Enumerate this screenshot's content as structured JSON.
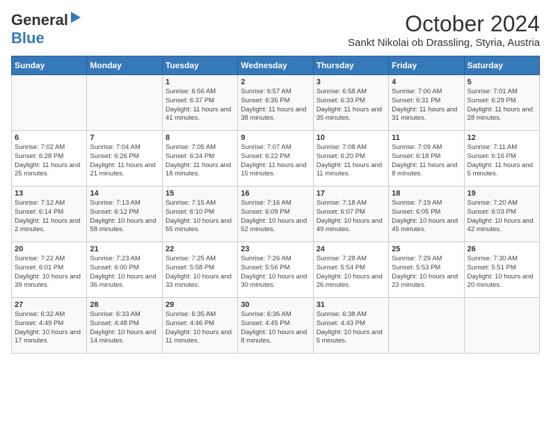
{
  "header": {
    "logo_general": "General",
    "logo_blue": "Blue",
    "title": "October 2024",
    "subtitle": "Sankt Nikolai ob Drassling, Styria, Austria"
  },
  "calendar": {
    "days_of_week": [
      "Sunday",
      "Monday",
      "Tuesday",
      "Wednesday",
      "Thursday",
      "Friday",
      "Saturday"
    ],
    "weeks": [
      [
        {
          "day": "",
          "info": ""
        },
        {
          "day": "",
          "info": ""
        },
        {
          "day": "1",
          "info": "Sunrise: 6:56 AM\nSunset: 6:37 PM\nDaylight: 11 hours and 41 minutes."
        },
        {
          "day": "2",
          "info": "Sunrise: 6:57 AM\nSunset: 6:35 PM\nDaylight: 11 hours and 38 minutes."
        },
        {
          "day": "3",
          "info": "Sunrise: 6:58 AM\nSunset: 6:33 PM\nDaylight: 11 hours and 35 minutes."
        },
        {
          "day": "4",
          "info": "Sunrise: 7:00 AM\nSunset: 6:31 PM\nDaylight: 11 hours and 31 minutes."
        },
        {
          "day": "5",
          "info": "Sunrise: 7:01 AM\nSunset: 6:29 PM\nDaylight: 11 hours and 28 minutes."
        }
      ],
      [
        {
          "day": "6",
          "info": "Sunrise: 7:02 AM\nSunset: 6:28 PM\nDaylight: 11 hours and 25 minutes."
        },
        {
          "day": "7",
          "info": "Sunrise: 7:04 AM\nSunset: 6:26 PM\nDaylight: 11 hours and 21 minutes."
        },
        {
          "day": "8",
          "info": "Sunrise: 7:05 AM\nSunset: 6:24 PM\nDaylight: 11 hours and 18 minutes."
        },
        {
          "day": "9",
          "info": "Sunrise: 7:07 AM\nSunset: 6:22 PM\nDaylight: 11 hours and 15 minutes."
        },
        {
          "day": "10",
          "info": "Sunrise: 7:08 AM\nSunset: 6:20 PM\nDaylight: 11 hours and 11 minutes."
        },
        {
          "day": "11",
          "info": "Sunrise: 7:09 AM\nSunset: 6:18 PM\nDaylight: 11 hours and 8 minutes."
        },
        {
          "day": "12",
          "info": "Sunrise: 7:11 AM\nSunset: 6:16 PM\nDaylight: 11 hours and 5 minutes."
        }
      ],
      [
        {
          "day": "13",
          "info": "Sunrise: 7:12 AM\nSunset: 6:14 PM\nDaylight: 11 hours and 2 minutes."
        },
        {
          "day": "14",
          "info": "Sunrise: 7:13 AM\nSunset: 6:12 PM\nDaylight: 10 hours and 58 minutes."
        },
        {
          "day": "15",
          "info": "Sunrise: 7:15 AM\nSunset: 6:10 PM\nDaylight: 10 hours and 55 minutes."
        },
        {
          "day": "16",
          "info": "Sunrise: 7:16 AM\nSunset: 6:09 PM\nDaylight: 10 hours and 52 minutes."
        },
        {
          "day": "17",
          "info": "Sunrise: 7:18 AM\nSunset: 6:07 PM\nDaylight: 10 hours and 49 minutes."
        },
        {
          "day": "18",
          "info": "Sunrise: 7:19 AM\nSunset: 6:05 PM\nDaylight: 10 hours and 45 minutes."
        },
        {
          "day": "19",
          "info": "Sunrise: 7:20 AM\nSunset: 6:03 PM\nDaylight: 10 hours and 42 minutes."
        }
      ],
      [
        {
          "day": "20",
          "info": "Sunrise: 7:22 AM\nSunset: 6:01 PM\nDaylight: 10 hours and 39 minutes."
        },
        {
          "day": "21",
          "info": "Sunrise: 7:23 AM\nSunset: 6:00 PM\nDaylight: 10 hours and 36 minutes."
        },
        {
          "day": "22",
          "info": "Sunrise: 7:25 AM\nSunset: 5:58 PM\nDaylight: 10 hours and 33 minutes."
        },
        {
          "day": "23",
          "info": "Sunrise: 7:26 AM\nSunset: 5:56 PM\nDaylight: 10 hours and 30 minutes."
        },
        {
          "day": "24",
          "info": "Sunrise: 7:28 AM\nSunset: 5:54 PM\nDaylight: 10 hours and 26 minutes."
        },
        {
          "day": "25",
          "info": "Sunrise: 7:29 AM\nSunset: 5:53 PM\nDaylight: 10 hours and 23 minutes."
        },
        {
          "day": "26",
          "info": "Sunrise: 7:30 AM\nSunset: 5:51 PM\nDaylight: 10 hours and 20 minutes."
        }
      ],
      [
        {
          "day": "27",
          "info": "Sunrise: 6:32 AM\nSunset: 4:49 PM\nDaylight: 10 hours and 17 minutes."
        },
        {
          "day": "28",
          "info": "Sunrise: 6:33 AM\nSunset: 4:48 PM\nDaylight: 10 hours and 14 minutes."
        },
        {
          "day": "29",
          "info": "Sunrise: 6:35 AM\nSunset: 4:46 PM\nDaylight: 10 hours and 11 minutes."
        },
        {
          "day": "30",
          "info": "Sunrise: 6:36 AM\nSunset: 4:45 PM\nDaylight: 10 hours and 8 minutes."
        },
        {
          "day": "31",
          "info": "Sunrise: 6:38 AM\nSunset: 4:43 PM\nDaylight: 10 hours and 5 minutes."
        },
        {
          "day": "",
          "info": ""
        },
        {
          "day": "",
          "info": ""
        }
      ]
    ]
  }
}
